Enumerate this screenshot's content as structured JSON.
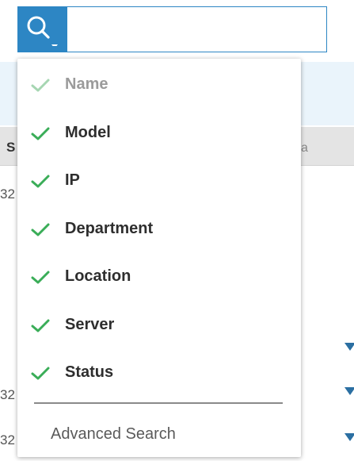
{
  "background": {
    "header_label": "S",
    "header_right": "a",
    "row_fragments": [
      "32",
      "32",
      "32"
    ]
  },
  "search": {
    "button_label": "search",
    "value": "",
    "placeholder": ""
  },
  "fields": [
    {
      "label": "Name",
      "checked": true,
      "muted": true
    },
    {
      "label": "Model",
      "checked": true,
      "muted": false
    },
    {
      "label": "IP",
      "checked": true,
      "muted": false
    },
    {
      "label": "Department",
      "checked": true,
      "muted": false
    },
    {
      "label": "Location",
      "checked": true,
      "muted": false
    },
    {
      "label": "Server",
      "checked": true,
      "muted": false
    },
    {
      "label": "Status",
      "checked": true,
      "muted": false
    }
  ],
  "advanced_search_label": "Advanced Search",
  "colors": {
    "accent": "#2d86c4",
    "check": "#3aad58",
    "check_muted": "#a6d6b2"
  },
  "icons": {
    "search": "magnifier-icon",
    "caret": "caret-down-icon",
    "check": "check-icon"
  }
}
